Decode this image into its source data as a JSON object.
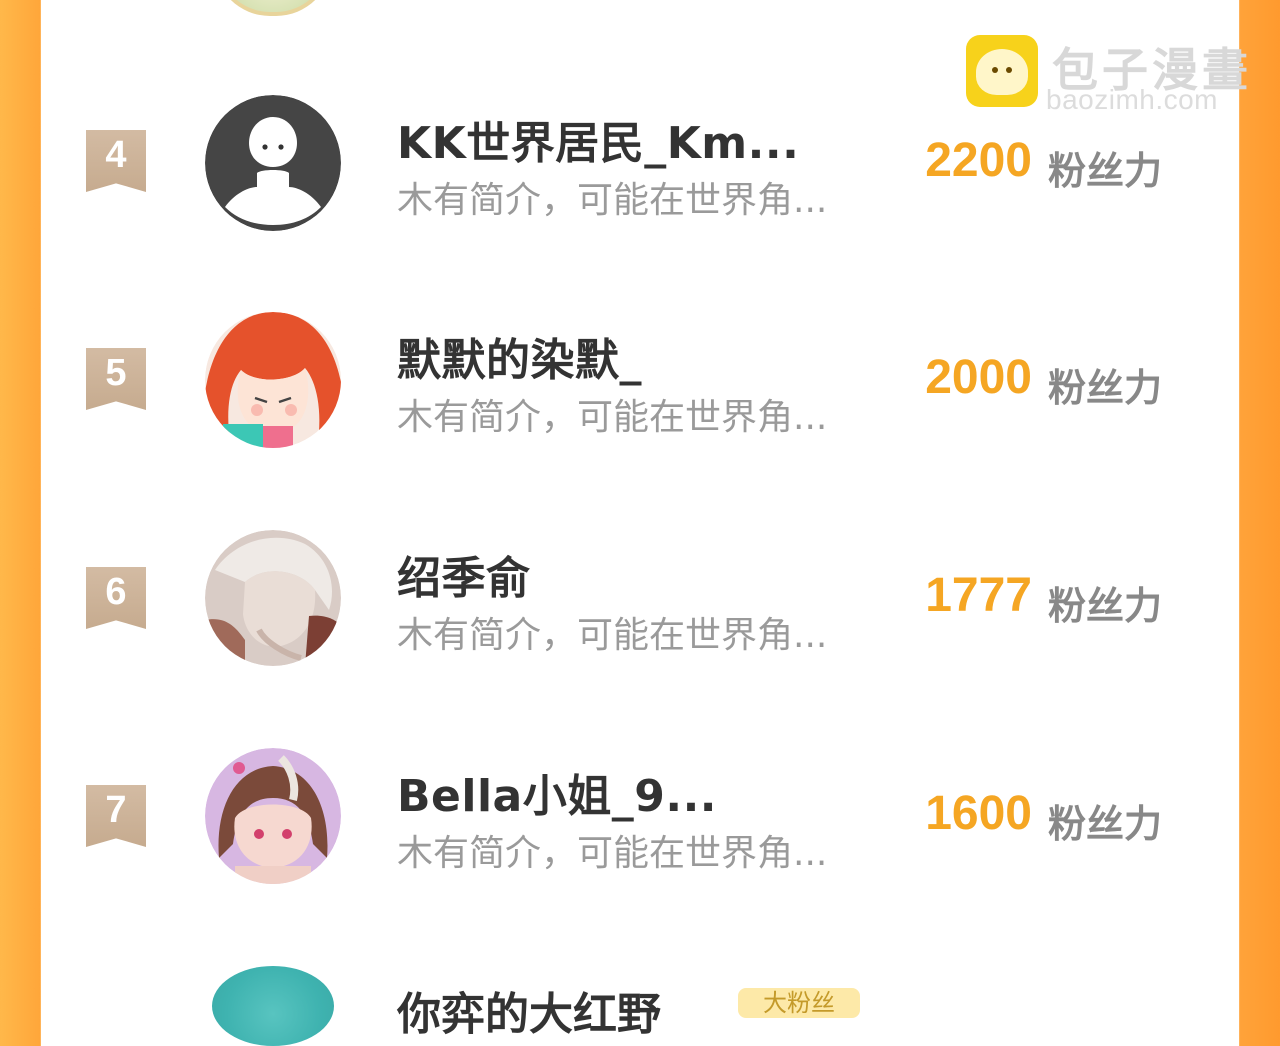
{
  "watermark": {
    "title": "包子漫畫",
    "url": "baozimh.com"
  },
  "unit_label": "粉丝力",
  "rows": [
    {
      "rank": "4",
      "name": "KK世界居民_Km...",
      "bio": "木有简介，可能在世界角...",
      "score": "2200",
      "avatar": "default-ghost"
    },
    {
      "rank": "5",
      "name": "默默的染默_",
      "bio": "木有简介，可能在世界角...",
      "score": "2000",
      "avatar": "anime-orange-hair"
    },
    {
      "rank": "6",
      "name": "绍季俞",
      "bio": "木有简介，可能在世界角...",
      "score": "1777",
      "avatar": "anime-white-hair"
    },
    {
      "rank": "7",
      "name": "Bella小姐_9...",
      "bio": "木有简介，可能在世界角...",
      "score": "1600",
      "avatar": "anime-brown-hair"
    }
  ],
  "next_row": {
    "name": "你弈的大红野",
    "tag": "大粉丝"
  }
}
